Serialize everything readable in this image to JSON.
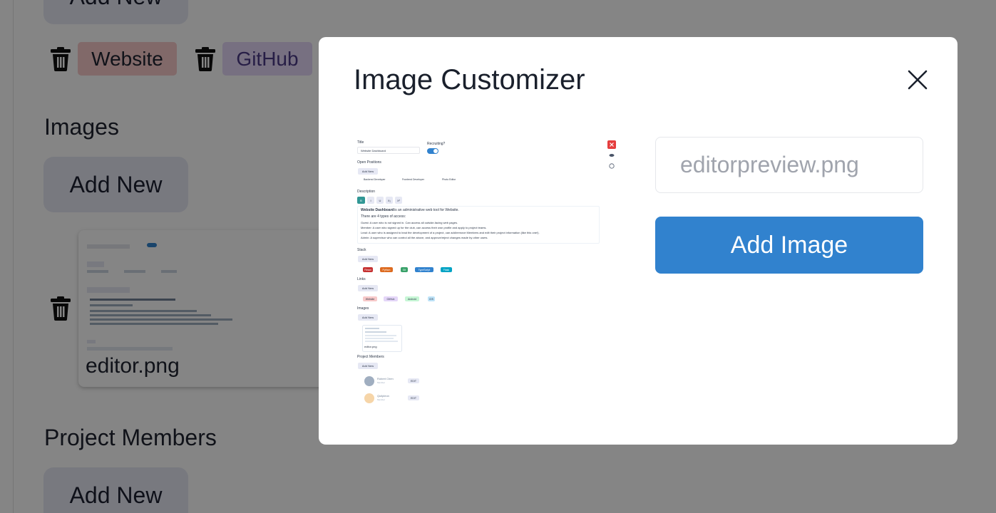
{
  "background": {
    "add_new_label": "Add New",
    "links_tags": [
      {
        "label": "Website",
        "color": "#f7c9c9"
      },
      {
        "label": "GitHub",
        "color": "#e4d6f8"
      }
    ],
    "images_title": "Images",
    "image_thumb_caption": "editor.png",
    "members_title": "Project Members"
  },
  "modal": {
    "title": "Image Customizer",
    "close_icon": "close-icon",
    "filename_input": {
      "value": "",
      "placeholder": "editorpreview.png"
    },
    "add_image_label": "Add Image",
    "accent_color": "#3182ce"
  },
  "preview": {
    "title_label": "Title",
    "title_value": "Website Dashboard",
    "recruiting_label": "Recruiting?",
    "open_positions_label": "Open Positions",
    "add_new": "Add New",
    "positions": [
      "Backend Developer",
      "Frontend Developer",
      "Photo Editor"
    ],
    "description_label": "Description",
    "toolbar": [
      "B",
      "I",
      "U",
      "X₂",
      "X²"
    ],
    "desc_line1_bold": "Website Dashboard",
    "desc_line1": "is an administrative web tool for Website.",
    "desc_line2": "There are 4 types of access:",
    "desc_lines": [
      "Guest: A user who is not signed in. Can access all outside-facing web pages.",
      "Member: A user who signed up for the club, can access their own profile and apply to project teams.",
      "Lead: A user who is assigned to lead the development of a project, can add/remove Members and edit their project information (like this one!).",
      "Admin: A supervisor who can control all the above, and approve/reject changes made by other users."
    ],
    "stack_label": "Stack",
    "stack": [
      {
        "label": "React",
        "color": "#c53030"
      },
      {
        "label": "Python",
        "color": "#dd6b20"
      },
      {
        "label": "Git",
        "color": "#38a169"
      },
      {
        "label": "TypeScript",
        "color": "#3182ce"
      },
      {
        "label": "Flask",
        "color": "#00a3c4"
      }
    ],
    "links_label": "Links",
    "links": [
      {
        "label": "Website",
        "color": "#f7c9c9"
      },
      {
        "label": "GitHub",
        "color": "#e4d6f8"
      },
      {
        "label": "Android",
        "color": "#c6f6d5"
      },
      {
        "label": "iOS",
        "color": "#bee3f8"
      }
    ],
    "images_label": "Images",
    "image_caption": "editor.png",
    "members_label": "Project Members",
    "members": [
      {
        "name": "Robert Chen",
        "role": "Member",
        "badge": "EDIT"
      },
      {
        "name": "Quilpleon",
        "role": "Member",
        "badge": "EDIT"
      }
    ]
  }
}
